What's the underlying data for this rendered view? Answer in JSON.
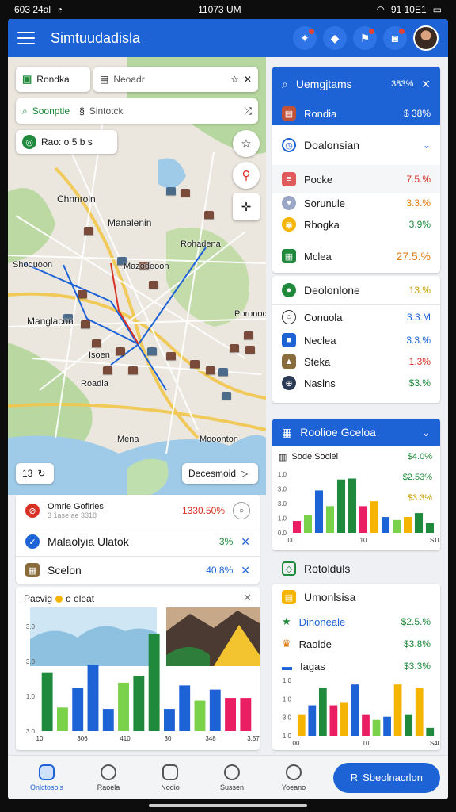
{
  "status": {
    "left": "603 24al",
    "time": "11073 UM",
    "right": "91 10E1"
  },
  "app": {
    "title": "Simtuudadisla"
  },
  "map": {
    "chip_layer": "Rondka",
    "search_placeholder": "Neoadr",
    "chip_search2": "Soonptie",
    "chip_search2_b": "Sintotck",
    "chip_info": "Rao: o 5 b s",
    "labels": {
      "l1": "Chnnroln",
      "l2": "Manalenin",
      "l3": "Rohadena",
      "l4": "Shoduoon",
      "l5": "Mazodeoon",
      "l6": "Manglacon",
      "l7": "Isoen",
      "l8": "Poronoc",
      "l9": "Roadia",
      "l10": "Mena",
      "l11": "Mooonton"
    },
    "zoom_label": "13",
    "dir_label": "Decesmoid"
  },
  "alerts": [
    {
      "title": "Omrie Gofiries",
      "sub": "3 1ase ae 3318",
      "value": "1330.50%",
      "color": "#d93025"
    },
    {
      "title": "Malaolyia Ulatok",
      "value": "3%",
      "color": "#1e63d6"
    },
    {
      "title": "Scelon",
      "value": "40.8%",
      "color": "#8a6b3b"
    }
  ],
  "chart_left": {
    "title": "Pacvig",
    "title_b": "o eleat",
    "chart_data": {
      "type": "bar",
      "categories": [
        "10",
        "",
        "",
        "",
        "",
        "",
        "",
        "",
        "",
        "",
        "",
        "",
        "",
        ""
      ],
      "x_ticks": [
        "10",
        "306",
        "410",
        "30",
        "348",
        "3.57"
      ],
      "values": [
        4.2,
        1.7,
        3.1,
        4.8,
        1.6,
        3.5,
        4.0,
        7.0,
        1.6,
        3.3,
        2.2,
        3.0,
        2.4,
        2.4
      ],
      "colors": [
        "#1f8a3b",
        "#7ad14a",
        "#1e63d6",
        "#1e63d6",
        "#1e63d6",
        "#7ad14a",
        "#1f8a3b",
        "#1f8a3b",
        "#1e63d6",
        "#1e63d6",
        "#7ad14a",
        "#1e63d6",
        "#e91e63",
        "#e91e63"
      ],
      "y_ticks": [
        "3.0",
        "3.0",
        "1.0",
        "3.0"
      ]
    }
  },
  "panel1": {
    "header": "Uemgjtams",
    "header_value": "383%",
    "item_sub": "Rondia",
    "item_sub_value": "$ 38%",
    "group": "Doalonsian",
    "rows": [
      {
        "label": "Pocke",
        "value": "7.5.%",
        "cls": "red"
      },
      {
        "label": "Sorunule",
        "value": "3.3.%",
        "cls": "orange"
      },
      {
        "label": "Rbogka",
        "value": "3.9%",
        "cls": "green"
      },
      {
        "label": "Mclea",
        "value": "27.5.%",
        "cls": "orange"
      }
    ]
  },
  "panel2": {
    "header": "Deolonlone",
    "header_value": "13.%",
    "rows": [
      {
        "label": "Conuola",
        "value": "3.3.M",
        "cls": "blue"
      },
      {
        "label": "Neclea",
        "value": "3.3.%",
        "cls": "blue"
      },
      {
        "label": "Steka",
        "value": "1.3%",
        "cls": "red"
      },
      {
        "label": "Naslns",
        "value": "$3.%",
        "cls": "green"
      }
    ]
  },
  "panel3": {
    "header": "Roolioe Gceloa",
    "legend": [
      {
        "label": "Sode Sociei",
        "value": "$4.0%",
        "cls": "green"
      },
      {
        "label": "",
        "value": "$2.53%",
        "cls": "green"
      },
      {
        "label": "",
        "value": "$3.3%",
        "cls": "yellow"
      }
    ],
    "chart_data": {
      "type": "bar",
      "x_ticks": [
        "00",
        "10",
        "S10"
      ],
      "y_ticks": [
        "1.0",
        "3.0",
        "3.0",
        "1.0",
        "0.0"
      ],
      "values": [
        1.2,
        1.8,
        4.3,
        2.7,
        5.4,
        5.5,
        2.7,
        3.2,
        1.6,
        1.3,
        1.6,
        2.0,
        1.0
      ],
      "colors": [
        "#e91e63",
        "#7ad14a",
        "#1e63d6",
        "#7ad14a",
        "#1f8a3b",
        "#1f8a3b",
        "#e91e63",
        "#f4b400",
        "#1e63d6",
        "#7ad14a",
        "#f4b400",
        "#1f8a3b",
        "#1f8a3b"
      ]
    }
  },
  "panel4": {
    "header": "Rotolduls",
    "title": "Umonlsisa",
    "rows": [
      {
        "label": "Dinoneale",
        "value": "$2.5.%",
        "cls": "green"
      },
      {
        "label": "Raolde",
        "value": "$3.8%",
        "cls": "green"
      },
      {
        "label": "Iagas",
        "value": "$3.3%",
        "cls": "green"
      }
    ],
    "chart_data": {
      "type": "bar",
      "x_ticks": [
        "00",
        "10",
        "S40"
      ],
      "y_ticks": [
        "1.0",
        "1.0",
        "3.0",
        "1.0"
      ],
      "values": [
        1.3,
        1.9,
        3.0,
        1.9,
        2.1,
        3.2,
        1.3,
        1.0,
        1.2,
        3.2,
        1.3,
        3.0,
        0.5
      ],
      "colors": [
        "#f4b400",
        "#1e63d6",
        "#1f8a3b",
        "#e91e63",
        "#f4b400",
        "#1e63d6",
        "#e91e63",
        "#7ad14a",
        "#1e63d6",
        "#f4b400",
        "#1f8a3b",
        "#f4b400",
        "#1f8a3b"
      ]
    }
  },
  "nav": {
    "items": [
      "Onlctosols",
      "Raoela",
      "Nodio",
      "Sussen",
      "Yoeano"
    ],
    "fab": "Sbeolnacrlon"
  },
  "colors": {
    "primary": "#1e63d6",
    "background": "#eef0f3"
  }
}
